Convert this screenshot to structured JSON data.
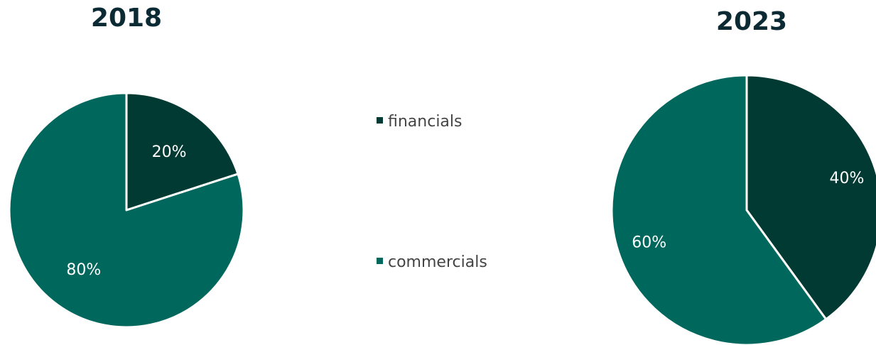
{
  "chart_data": [
    {
      "type": "pie",
      "title": "2018",
      "categories": [
        "financials",
        "commercials"
      ],
      "values": [
        20,
        80
      ],
      "labels": [
        "20%",
        "80%"
      ],
      "colors": [
        "#003a33",
        "#00675d"
      ]
    },
    {
      "type": "pie",
      "title": "2023",
      "categories": [
        "financials",
        "commercials"
      ],
      "values": [
        40,
        60
      ],
      "labels": [
        "40%",
        "60%"
      ],
      "colors": [
        "#003a33",
        "#00675d"
      ]
    }
  ],
  "legend": {
    "placement": "center",
    "items": [
      {
        "label": "financials",
        "color": "#003a33"
      },
      {
        "label": "commercials",
        "color": "#00675d"
      }
    ]
  }
}
